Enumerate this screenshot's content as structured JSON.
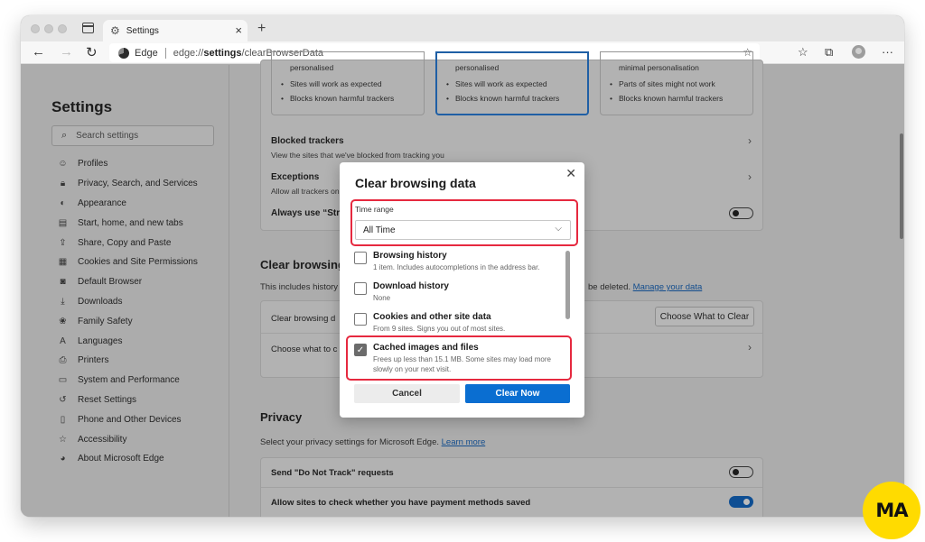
{
  "browser": {
    "tab_title": "Settings",
    "address": {
      "brand": "Edge",
      "protocol": "edge://",
      "host": "settings",
      "path": "/clearBrowserData"
    }
  },
  "sidebar": {
    "title": "Settings",
    "search_placeholder": "Search settings",
    "items": [
      {
        "label": "Profiles",
        "icon": "profile-icon"
      },
      {
        "label": "Privacy, Search, and Services",
        "icon": "lock-icon"
      },
      {
        "label": "Appearance",
        "icon": "palette-icon"
      },
      {
        "label": "Start, home, and new tabs",
        "icon": "home-tabs-icon"
      },
      {
        "label": "Share, Copy and Paste",
        "icon": "share-icon"
      },
      {
        "label": "Cookies and Site Permissions",
        "icon": "cookies-icon"
      },
      {
        "label": "Default Browser",
        "icon": "default-browser-icon"
      },
      {
        "label": "Downloads",
        "icon": "download-icon"
      },
      {
        "label": "Family Safety",
        "icon": "family-icon"
      },
      {
        "label": "Languages",
        "icon": "languages-icon"
      },
      {
        "label": "Printers",
        "icon": "printer-icon"
      },
      {
        "label": "System and Performance",
        "icon": "laptop-icon"
      },
      {
        "label": "Reset Settings",
        "icon": "reset-icon"
      },
      {
        "label": "Phone and Other Devices",
        "icon": "phone-icon"
      },
      {
        "label": "Accessibility",
        "icon": "accessibility-icon"
      },
      {
        "label": "About Microsoft Edge",
        "icon": "edge-logo-icon"
      }
    ]
  },
  "prevention_cards": [
    {
      "lines": [
        "personalised",
        "Sites will work as expected",
        "Blocks known harmful trackers"
      ],
      "selected": false
    },
    {
      "lines": [
        "personalised",
        "Sites will work as expected",
        "Blocks known harmful trackers"
      ],
      "selected": true
    },
    {
      "lines": [
        "minimal personalisation",
        "Parts of sites might not work",
        "Blocks known harmful trackers"
      ],
      "selected": false
    }
  ],
  "tracking_rows": {
    "blocked_title": "Blocked trackers",
    "blocked_sub": "View the sites that we've blocked from tracking you",
    "exceptions_title": "Exceptions",
    "exceptions_sub": "Allow all trackers on",
    "strict_title": "Always use “Stric",
    "strict_on": false
  },
  "clear_section": {
    "title": "Clear browsing",
    "desc_start": "This includes history",
    "desc_end": "be deleted.",
    "link": "Manage your data",
    "row1": "Clear browsing d",
    "row1_button": "Choose What to Clear",
    "row2": "Choose what to c"
  },
  "privacy_section": {
    "title": "Privacy",
    "desc": "Select your privacy settings for Microsoft Edge.",
    "link": "Learn more",
    "dnt_label": "Send \"Do Not Track\" requests",
    "dnt_on": false,
    "payment_label": "Allow sites to check whether you have payment methods saved",
    "payment_on": true
  },
  "dialog": {
    "title": "Clear browsing data",
    "time_range_label": "Time range",
    "time_range_value": "All Time",
    "options": [
      {
        "title": "Browsing history",
        "sub": "1 item. Includes autocompletions in the address bar.",
        "checked": false
      },
      {
        "title": "Download history",
        "sub": "None",
        "checked": false
      },
      {
        "title": "Cookies and other site data",
        "sub": "From 9 sites. Signs you out of most sites.",
        "checked": false
      },
      {
        "title": "Cached images and files",
        "sub": "Frees up less than 15.1 MB. Some sites may load more slowly on your next visit.",
        "checked": true
      }
    ],
    "cancel_label": "Cancel",
    "clear_label": "Clear Now",
    "highlight_color": "#e6293f",
    "primary_color": "#0a6ed1"
  },
  "watermark": "MA"
}
